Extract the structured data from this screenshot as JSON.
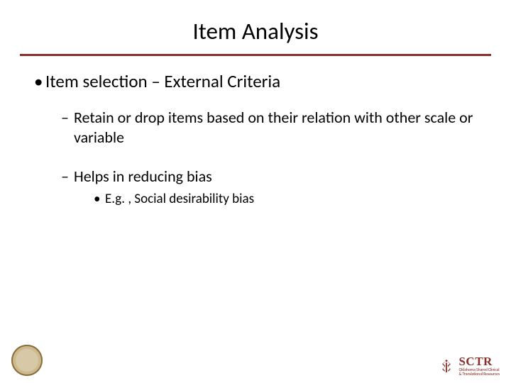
{
  "title": "Item Analysis",
  "bullets": {
    "item_selection": "Item selection – External Criteria",
    "retain_drop": "Retain or drop items based on their relation with other scale or variable",
    "reduce_bias": "Helps in reducing bias",
    "example": "E.g. , Social desirability bias"
  },
  "footer": {
    "seal_alt": "institution-seal",
    "sctr_label": "SCTR",
    "sctr_sub1": "Oklahoma Shared Clinical",
    "sctr_sub2": "& Translational Resources"
  },
  "colors": {
    "accent": "#8a2f2a"
  }
}
